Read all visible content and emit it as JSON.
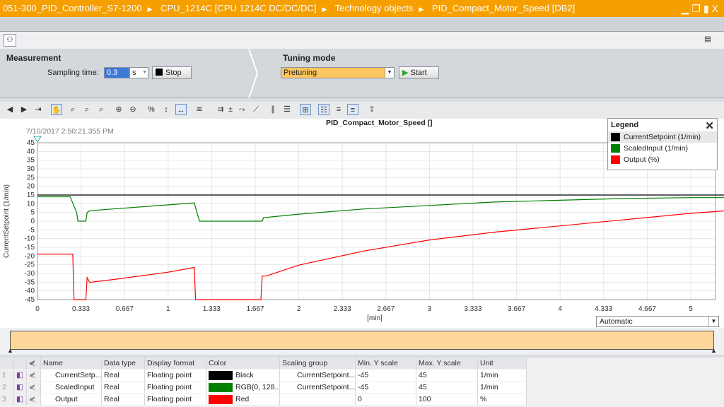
{
  "titlebar": {
    "breadcrumb": [
      "051-300_PID_Controller_S7-1200",
      "CPU_1214C [CPU 1214C DC/DC/DC]",
      "Technology objects",
      "PID_Compact_Motor_Speed [DB2]"
    ],
    "separator": "▶",
    "window_buttons": "▁❐▮X"
  },
  "measurement": {
    "title": "Measurement",
    "sampling_label": "Sampling time:",
    "sampling_value": "0.3",
    "unit": "s",
    "stop_label": "Stop"
  },
  "tuning": {
    "title": "Tuning mode",
    "mode": "Pretuning",
    "start_label": "Start"
  },
  "toolbar": {
    "icons": [
      "back-icon",
      "forward-icon",
      "fit-icon",
      "pan-icon",
      "zoom-box-icon",
      "zoom-x-icon",
      "zoom-y-icon",
      "zoom-in-icon",
      "zoom-out-icon",
      "zoom-100-icon",
      "zoom-y-100-icon",
      "zoom-x-100-icon",
      "chart-icon",
      "measure-icon",
      "plus-minus-icon",
      "line-icon",
      "diagonal-icon",
      "vertical-cursors-icon",
      "horizontal-cursors-icon",
      "cursor-icon",
      "legend-icon",
      "align-left-icon",
      "align-right-icon",
      "export-icon"
    ]
  },
  "chart": {
    "timestamp": "7/10/2017  2:50:21.355 PM",
    "title": "PID_Compact_Motor_Speed []",
    "time_axis_mode": "Automatic"
  },
  "legend": {
    "title": "Legend",
    "close": "✕",
    "items": [
      {
        "label": "CurrentSetpoint (1/min)",
        "color": "#000000"
      },
      {
        "label": "ScaledInput (1/min)",
        "color": "#008000"
      },
      {
        "label": "Output (%)",
        "color": "#ff0000"
      }
    ]
  },
  "chart_data": {
    "type": "line",
    "title": "PID_Compact_Motor_Speed []",
    "xlabel": "[min]",
    "ylabel": "CurrentSetpoint (1/min)",
    "xlim": [
      0,
      5.33
    ],
    "ylim": [
      -45,
      45
    ],
    "xticks": [
      "0",
      "0.333",
      "0.667",
      "1",
      "1.333",
      "1.667",
      "2",
      "2.333",
      "2.667",
      "3",
      "3.333",
      "3.667",
      "4",
      "4.333",
      "4.667",
      "5"
    ],
    "yticks": [
      "45",
      "40",
      "35",
      "30",
      "25",
      "20",
      "15",
      "10",
      "5",
      "0",
      "-5",
      "-10",
      "-15",
      "-20",
      "-25",
      "-30",
      "-35",
      "-40",
      "-45"
    ],
    "grid": true,
    "legend_position": "top-right",
    "series": [
      {
        "name": "CurrentSetpoint (1/min)",
        "color": "#000000",
        "scale": [
          -45,
          45
        ],
        "points": [
          [
            0,
            15
          ],
          [
            5.33,
            15
          ]
        ]
      },
      {
        "name": "ScaledInput (1/min)",
        "color": "#008000",
        "scale": [
          -45,
          45
        ],
        "points": [
          [
            0,
            14
          ],
          [
            0.25,
            14
          ],
          [
            0.3,
            5
          ],
          [
            0.31,
            0
          ],
          [
            0.37,
            0
          ],
          [
            0.38,
            5
          ],
          [
            0.4,
            6
          ],
          [
            1.2,
            10.5
          ],
          [
            1.22,
            5
          ],
          [
            1.24,
            0
          ],
          [
            1.72,
            0
          ],
          [
            1.73,
            2
          ],
          [
            2,
            4
          ],
          [
            2.5,
            7
          ],
          [
            3,
            9
          ],
          [
            3.5,
            11
          ],
          [
            4,
            12
          ],
          [
            4.5,
            13
          ],
          [
            5,
            13.5
          ],
          [
            5.33,
            13.5
          ]
        ]
      },
      {
        "name": "Output (%)",
        "color": "#ff0000",
        "scale": [
          0,
          100
        ],
        "points": [
          [
            0,
            29
          ],
          [
            0.27,
            29
          ],
          [
            0.28,
            0
          ],
          [
            0.37,
            0
          ],
          [
            0.38,
            14
          ],
          [
            0.4,
            11
          ],
          [
            0.6,
            13
          ],
          [
            1,
            17.5
          ],
          [
            1.2,
            20.5
          ],
          [
            1.21,
            0
          ],
          [
            1.71,
            0
          ],
          [
            1.72,
            15
          ],
          [
            1.75,
            15
          ],
          [
            2,
            22
          ],
          [
            2.5,
            31
          ],
          [
            3,
            38
          ],
          [
            3.5,
            43
          ],
          [
            4,
            47
          ],
          [
            4.5,
            51
          ],
          [
            5,
            55
          ],
          [
            5.33,
            57
          ]
        ]
      }
    ]
  },
  "table": {
    "headers": [
      "Name",
      "Data type",
      "Display format",
      "Color",
      "Scaling group",
      "Min. Y scale",
      "Max. Y scale",
      "Unit"
    ],
    "rows": [
      {
        "n": "1",
        "name": "CurrentSetp...",
        "type": "Real",
        "format": "Floating point",
        "color": "#000000",
        "color_name": "Black",
        "group": "CurrentSetpoint...",
        "min": "-45",
        "max": "45",
        "unit": "1/min"
      },
      {
        "n": "2",
        "name": "ScaledInput",
        "type": "Real",
        "format": "Floating point",
        "color": "#008000",
        "color_name": "RGB(0, 128...",
        "group": "CurrentSetpoint...",
        "min": "-45",
        "max": "45",
        "unit": "1/min"
      },
      {
        "n": "3",
        "name": "Output",
        "type": "Real",
        "format": "Floating point",
        "color": "#ff0000",
        "color_name": "Red",
        "group": "",
        "min": "0",
        "max": "100",
        "unit": "%"
      }
    ]
  }
}
